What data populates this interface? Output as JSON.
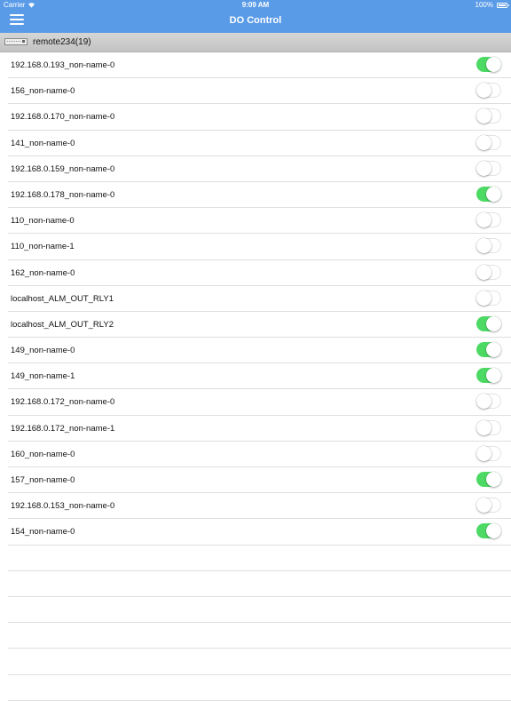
{
  "status_bar": {
    "carrier": "Carrier",
    "time": "9:09 AM",
    "battery": "100%"
  },
  "nav": {
    "title": "DO Control",
    "menu_icon": "hamburger-icon"
  },
  "section": {
    "label": "remote234(19)",
    "icon": "device-icon"
  },
  "colors": {
    "nav_bg": "#5a9be8",
    "switch_on": "#4cd964"
  },
  "items": [
    {
      "label": "192.168.0.193_non-name-0",
      "on": true
    },
    {
      "label": "156_non-name-0",
      "on": false
    },
    {
      "label": "192.168.0.170_non-name-0",
      "on": false
    },
    {
      "label": "141_non-name-0",
      "on": false
    },
    {
      "label": "192.168.0.159_non-name-0",
      "on": false
    },
    {
      "label": "192.168.0.178_non-name-0",
      "on": true
    },
    {
      "label": "110_non-name-0",
      "on": false
    },
    {
      "label": "110_non-name-1",
      "on": false
    },
    {
      "label": "162_non-name-0",
      "on": false
    },
    {
      "label": "localhost_ALM_OUT_RLY1",
      "on": false
    },
    {
      "label": "localhost_ALM_OUT_RLY2",
      "on": true
    },
    {
      "label": "149_non-name-0",
      "on": true
    },
    {
      "label": "149_non-name-1",
      "on": true
    },
    {
      "label": "192.168.0.172_non-name-0",
      "on": false
    },
    {
      "label": "192.168.0.172_non-name-1",
      "on": false
    },
    {
      "label": "160_non-name-0",
      "on": false
    },
    {
      "label": "157_non-name-0",
      "on": true
    },
    {
      "label": "192.168.0.153_non-name-0",
      "on": false
    },
    {
      "label": "154_non-name-0",
      "on": true
    }
  ]
}
